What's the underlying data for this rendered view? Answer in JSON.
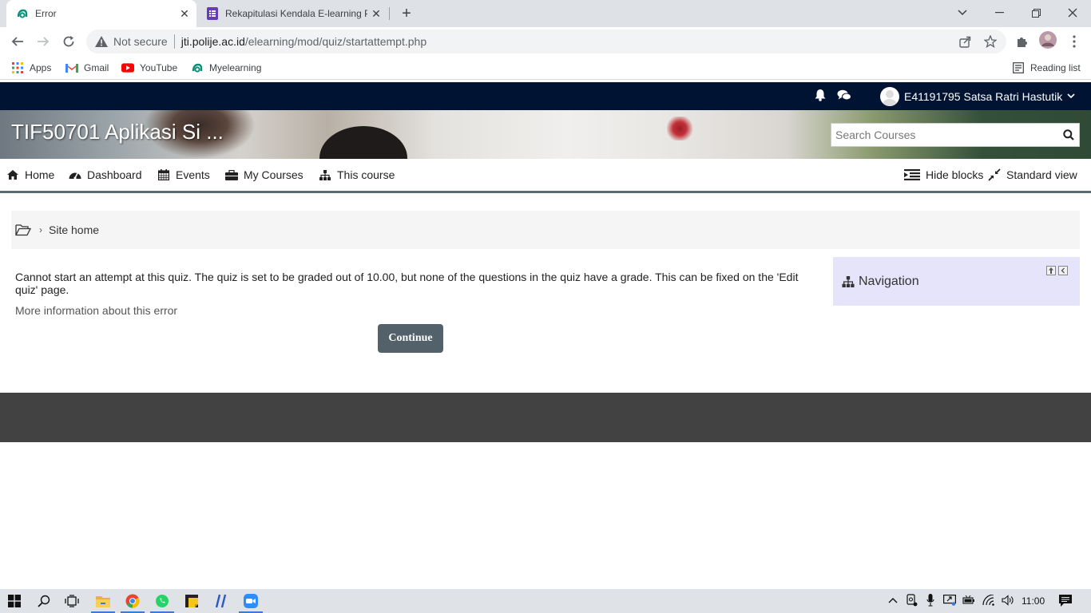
{
  "browser": {
    "tabs": [
      {
        "title": "Error",
        "active": true
      },
      {
        "title": "Rekapitulasi Kendala E-learning P",
        "active": false
      }
    ],
    "omnibox": {
      "security_label": "Not secure",
      "url_host": "jti.polije.ac.id",
      "url_path": "/elearning/mod/quiz/startattempt.php"
    },
    "bookmarks": [
      {
        "label": "Apps",
        "icon": "apps-grid-icon"
      },
      {
        "label": "Gmail",
        "icon": "gmail-icon"
      },
      {
        "label": "YouTube",
        "icon": "youtube-icon"
      },
      {
        "label": "Myelearning",
        "icon": "moodle-icon"
      }
    ],
    "reading_list_label": "Reading list"
  },
  "moodle": {
    "navbar": {
      "user_name": "E41191795 Satsa Ratri Hastutik"
    },
    "header": {
      "course_title": "TIF50701 Aplikasi Si ...",
      "search_placeholder": "Search Courses"
    },
    "menu": {
      "home": "Home",
      "dashboard": "Dashboard",
      "events": "Events",
      "my_courses": "My Courses",
      "this_course": "This course",
      "hide_blocks": "Hide blocks",
      "standard_view": "Standard view"
    },
    "breadcrumb": {
      "site_home": "Site home"
    },
    "error": {
      "message": "Cannot start an attempt at this quiz. The quiz is set to be graded out of 10.00, but none of the questions in the quiz have a grade. This can be fixed on the 'Edit quiz' page.",
      "more_info": "More information about this error",
      "continue_label": "Continue"
    },
    "navigation_block": {
      "title": "Navigation"
    }
  },
  "taskbar": {
    "time": "11:00"
  },
  "colors": {
    "navbar_bg": "#001333",
    "button_bg": "#53626a",
    "nav_block_bg": "#e6e4fb",
    "footer_bg": "#424242"
  }
}
